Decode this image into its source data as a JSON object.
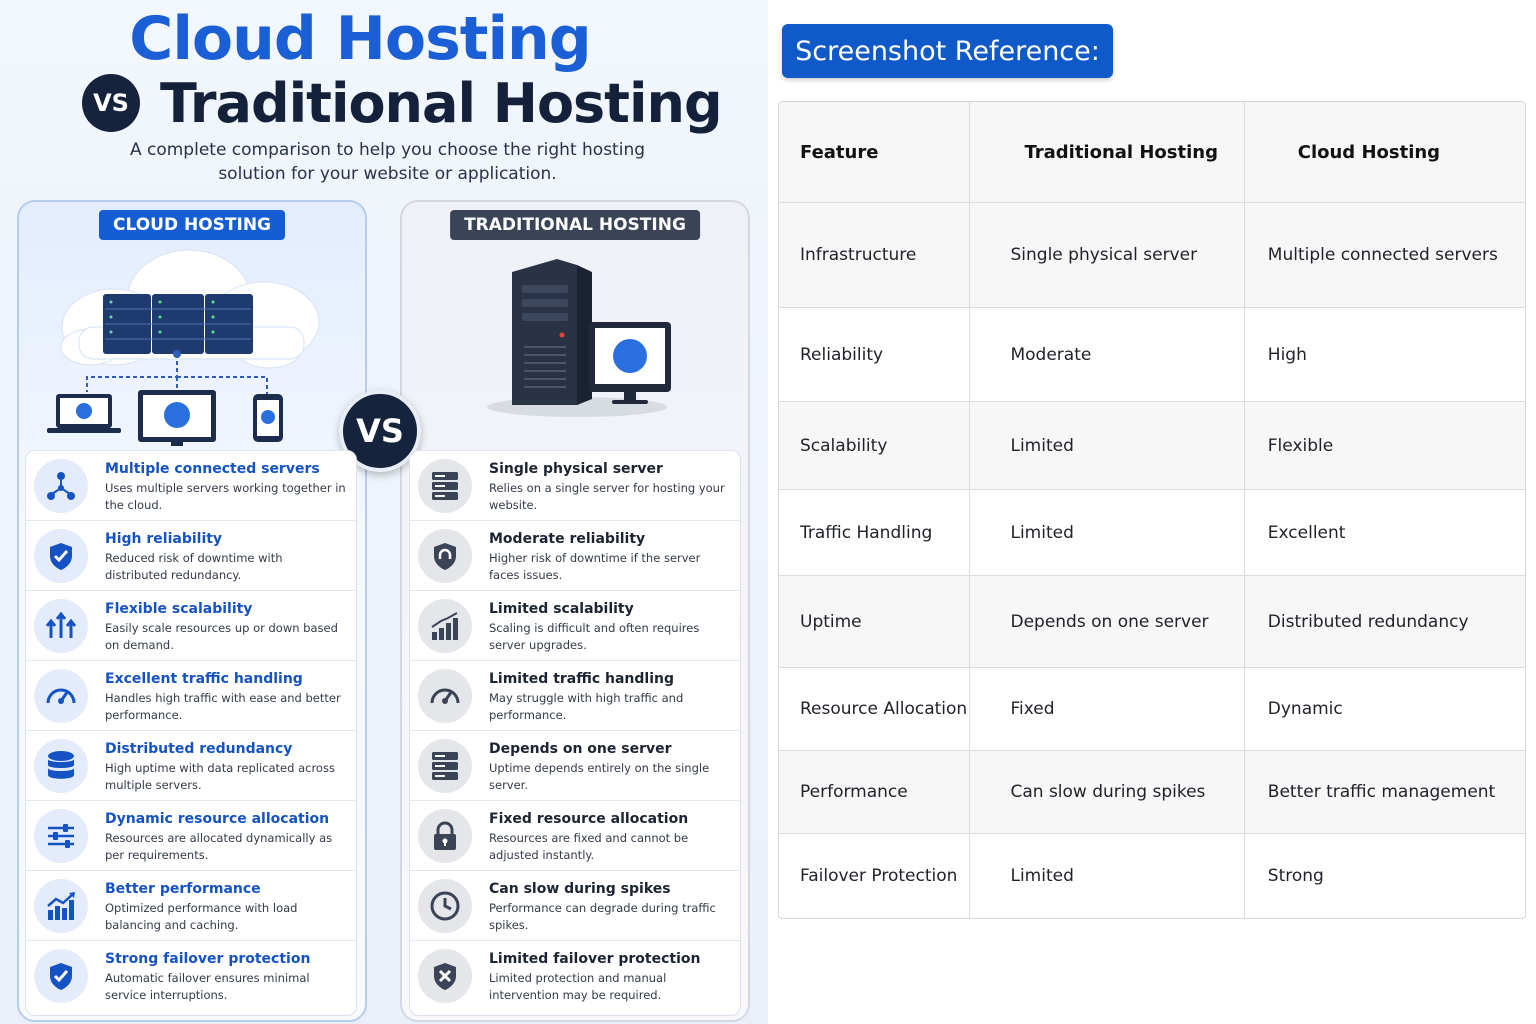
{
  "header": {
    "title_cloud": "Cloud Hosting",
    "vs": "VS",
    "title_traditional": "Traditional Hosting",
    "subtitle": "A complete comparison to help you choose the right hosting solution for your website or application."
  },
  "cloud_panel": {
    "badge": "CLOUD HOSTING",
    "items": [
      {
        "icon": "network-nodes-icon",
        "title": "Multiple connected servers",
        "desc": "Uses multiple servers working together in the cloud."
      },
      {
        "icon": "shield-check-icon",
        "title": "High reliability",
        "desc": "Reduced risk of downtime with distributed redundancy."
      },
      {
        "icon": "arrows-up-icon",
        "title": "Flexible scalability",
        "desc": "Easily scale resources up or down based on demand."
      },
      {
        "icon": "speedometer-icon",
        "title": "Excellent traffic handling",
        "desc": "Handles high traffic with ease and better performance."
      },
      {
        "icon": "database-icon",
        "title": "Distributed redundancy",
        "desc": "High uptime with data replicated across multiple servers."
      },
      {
        "icon": "sliders-icon",
        "title": "Dynamic resource allocation",
        "desc": "Resources are allocated dynamically as per requirements."
      },
      {
        "icon": "growth-chart-icon",
        "title": "Better performance",
        "desc": "Optimized performance with load balancing and caching."
      },
      {
        "icon": "shield-check-icon",
        "title": "Strong failover protection",
        "desc": "Automatic failover ensures minimal service interruptions."
      }
    ]
  },
  "traditional_panel": {
    "badge": "TRADITIONAL HOSTING",
    "items": [
      {
        "icon": "server-rack-icon",
        "title": "Single physical server",
        "desc": "Relies on a single server for hosting your website."
      },
      {
        "icon": "shield-alert-icon",
        "title": "Moderate reliability",
        "desc": "Higher risk of downtime if the server faces issues."
      },
      {
        "icon": "bar-chart-icon",
        "title": "Limited scalability",
        "desc": "Scaling is difficult and often requires server upgrades."
      },
      {
        "icon": "speedometer-icon",
        "title": "Limited traffic handling",
        "desc": "May struggle with high traffic and performance."
      },
      {
        "icon": "server-rack-icon",
        "title": "Depends on one server",
        "desc": "Uptime depends entirely on the single server."
      },
      {
        "icon": "lock-icon",
        "title": "Fixed resource allocation",
        "desc": "Resources are fixed and cannot be adjusted instantly."
      },
      {
        "icon": "clock-icon",
        "title": "Can slow during spikes",
        "desc": "Performance can degrade during traffic spikes."
      },
      {
        "icon": "shield-x-icon",
        "title": "Limited failover protection",
        "desc": "Limited protection and manual intervention may be required."
      }
    ]
  },
  "reference": {
    "button": "Screenshot Reference:",
    "headers": [
      "Feature",
      "Traditional Hosting",
      "Cloud Hosting"
    ],
    "rows": [
      [
        "Infrastructure",
        "Single physical server",
        "Multiple connected servers"
      ],
      [
        "Reliability",
        "Moderate",
        "High"
      ],
      [
        "Scalability",
        "Limited",
        "Flexible"
      ],
      [
        "Traffic Handling",
        "Limited",
        "Excellent"
      ],
      [
        "Uptime",
        "Depends on one server",
        "Distributed redundancy"
      ],
      [
        "Resource Allocation",
        "Fixed",
        "Dynamic"
      ],
      [
        "Performance",
        "Can slow during spikes",
        "Better traffic management"
      ],
      [
        "Failover Protection",
        "Limited",
        "Strong"
      ]
    ]
  },
  "colors": {
    "cloud_blue": "#1553c4",
    "dark_navy": "#16233d",
    "trad_gray": "#3a4456"
  }
}
